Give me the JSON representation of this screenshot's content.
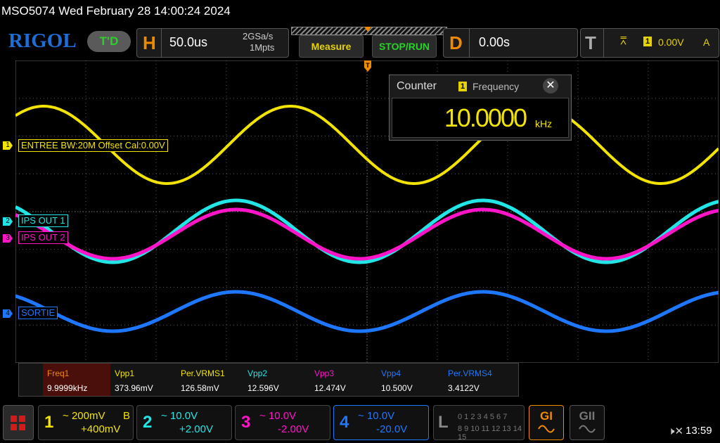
{
  "title": "MSO5074  Wed February 28 14:00:24 2024",
  "logo": "RIGOL",
  "trigger_status": "T'D",
  "horizontal": {
    "letter": "H",
    "timebase": "50.0us",
    "rate": "2GSa/s",
    "memory": "1Mpts"
  },
  "buttons": {
    "measure": "Measure",
    "stop_run": "STOP/RUN"
  },
  "delay": {
    "letter": "D",
    "value": "0.00s"
  },
  "trigger": {
    "letter": "T",
    "edge_icon": "rising-edge-icon",
    "source": "1",
    "level": "0.00V",
    "mode": "A"
  },
  "counter": {
    "title": "Counter",
    "source": "1",
    "mode": "Frequency",
    "close": "✕",
    "value": "10.0000",
    "unit": "kHz"
  },
  "channels": [
    {
      "id": "1",
      "label": "ENTREE BW:20M Offset Cal:0.00V",
      "color": "#f2e400",
      "scale": "200mV",
      "flag": "B",
      "offset": "+400mV"
    },
    {
      "id": "2",
      "label": "IPS OUT 1",
      "color": "#22e6e6",
      "scale": "10.0V",
      "flag": "",
      "offset": "+2.00V"
    },
    {
      "id": "3",
      "label": "IPS OUT 2",
      "color": "#ff14c8",
      "scale": "10.0V",
      "flag": "",
      "offset": "-2.00V"
    },
    {
      "id": "4",
      "label": "SORTIE",
      "color": "#1e78ff",
      "scale": "10.0V",
      "flag": "",
      "offset": "-20.0V"
    }
  ],
  "measurements": [
    {
      "name": "Freq1",
      "value": "9.9999kHz",
      "color": "#f08a00"
    },
    {
      "name": "Vpp1",
      "value": "373.96mV",
      "color": "#f2e400"
    },
    {
      "name": "Per.VRMS1",
      "value": "126.58mV",
      "color": "#f2e400"
    },
    {
      "name": "Vpp2",
      "value": "12.596V",
      "color": "#22e6e6"
    },
    {
      "name": "Vpp3",
      "value": "12.474V",
      "color": "#ff14c8"
    },
    {
      "name": "Vpp4",
      "value": "10.500V",
      "color": "#1e78ff"
    },
    {
      "name": "Per.VRMS4",
      "value": "3.4122V",
      "color": "#1e78ff"
    }
  ],
  "logic": {
    "letter": "L",
    "row1": "0 1 2 3  4 5 6 7",
    "row2": "8 9 10 11 12 13 14 15"
  },
  "generators": [
    {
      "label": "GI",
      "color": "#f08a00"
    },
    {
      "label": "GII",
      "color": "#777777"
    }
  ],
  "clock": "13:59"
}
